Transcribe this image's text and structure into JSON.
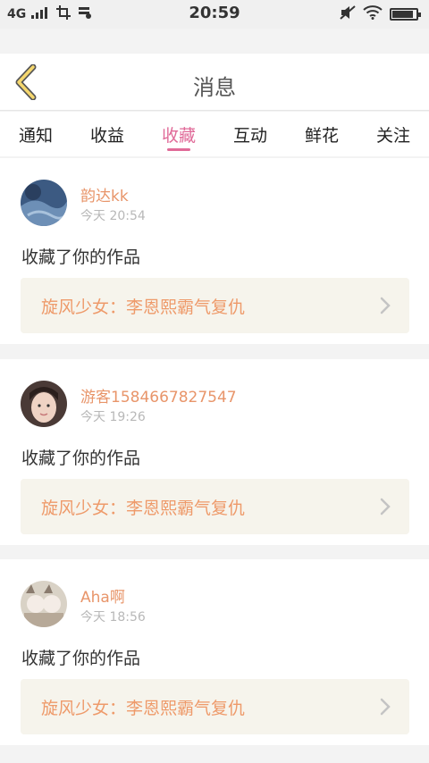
{
  "status_bar": {
    "network": "4G",
    "time": "20:59",
    "battery_level": 0.9
  },
  "header": {
    "title": "消息",
    "back_icon": "chevron-left-icon",
    "accent": "#f5d76e"
  },
  "tabs": [
    {
      "label": "通知",
      "active": false
    },
    {
      "label": "收益",
      "active": false
    },
    {
      "label": "收藏",
      "active": true
    },
    {
      "label": "互动",
      "active": false
    },
    {
      "label": "鲜花",
      "active": false
    },
    {
      "label": "关注",
      "active": false
    }
  ],
  "colors": {
    "active_tab": "#e06a98",
    "username": "#e8956a",
    "work_title": "#ee9a6a",
    "work_bg": "#f6f4ec"
  },
  "messages": [
    {
      "username": "韵达kk",
      "time": "今天 20:54",
      "action": "收藏了你的作品",
      "work_title": "旋风少女：李恩熙霸气复仇"
    },
    {
      "username": "游客1584667827547",
      "time": "今天 19:26",
      "action": "收藏了你的作品",
      "work_title": "旋风少女：李恩熙霸气复仇"
    },
    {
      "username": "Aha啊",
      "time": "今天 18:56",
      "action": "收藏了你的作品",
      "work_title": "旋风少女：李恩熙霸气复仇"
    }
  ]
}
